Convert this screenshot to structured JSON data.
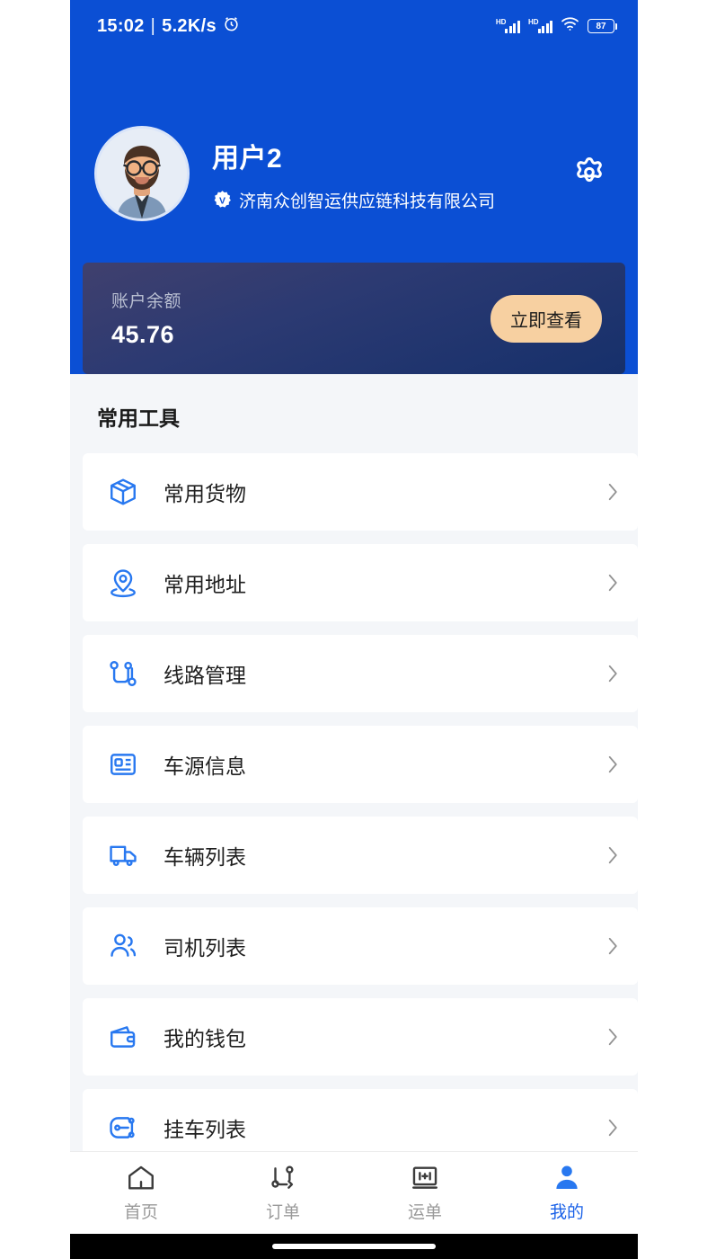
{
  "status_bar": {
    "time": "15:02",
    "separator": "|",
    "net_speed": "5.2K/s",
    "alarm_icon": "alarm-icon",
    "signal_label_1": "HD",
    "signal_label_2": "HD",
    "wifi_icon": "wifi-icon",
    "battery_level": "87"
  },
  "profile": {
    "avatar_icon": "user-avatar",
    "name": "用户2",
    "verified_badge": "verified-badge-icon",
    "company": "济南众创智运供应链科技有限公司",
    "settings_icon": "gear-icon"
  },
  "balance_card": {
    "label": "账户余额",
    "amount": "45.76",
    "button_label": "立即查看"
  },
  "tools": {
    "section_title": "常用工具",
    "items": [
      {
        "label": "常用货物",
        "icon": "box-icon"
      },
      {
        "label": "常用地址",
        "icon": "location-pin-icon"
      },
      {
        "label": "线路管理",
        "icon": "route-icon"
      },
      {
        "label": "车源信息",
        "icon": "vehicle-card-icon"
      },
      {
        "label": "车辆列表",
        "icon": "truck-icon"
      },
      {
        "label": "司机列表",
        "icon": "people-icon"
      },
      {
        "label": "我的钱包",
        "icon": "wallet-icon"
      },
      {
        "label": "挂车列表",
        "icon": "trailer-icon"
      }
    ]
  },
  "tabbar": {
    "items": [
      {
        "label": "首页",
        "icon": "home-icon",
        "active": false
      },
      {
        "label": "订单",
        "icon": "order-route-icon",
        "active": false
      },
      {
        "label": "运单",
        "icon": "waybill-icon",
        "active": false
      },
      {
        "label": "我的",
        "icon": "person-icon",
        "active": true
      }
    ]
  },
  "colors": {
    "brand_blue": "#0b4fd4",
    "accent_peach": "#f7d0a1",
    "page_bg": "#f4f6f9",
    "active_tab": "#1b62e8"
  }
}
